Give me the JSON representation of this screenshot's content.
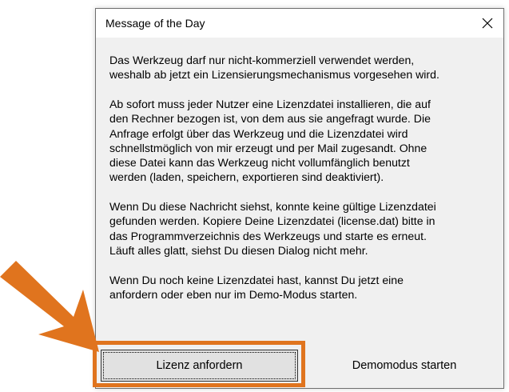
{
  "dialog": {
    "title": "Message of the Day",
    "close_icon": "close-x-icon",
    "paragraphs": [
      "Das Werkzeug darf nur nicht-kommerziell verwendet werden,\nweshalb ab jetzt ein Lizensierungsmechanismus vorgesehen wird.",
      "Ab sofort muss jeder Nutzer eine Lizenzdatei installieren, die auf\nden Rechner bezogen ist, von dem aus sie angefragt wurde. Die\nAnfrage erfolgt über das Werkzeug und die Lizenzdatei wird\nschnellstmöglich von mir erzeugt und per Mail zugesandt. Ohne\ndiese Datei kann das Werkzeug nicht vollumfänglich benutzt\nwerden (laden, speichern, exportieren sind deaktiviert).",
      "Wenn Du diese Nachricht siehst, konnte keine gültige Lizenzdatei\ngefunden werden. Kopiere Deine Lizenzdatei (license.dat) bitte in\ndas Programmverzeichnis des Werkzeugs und starte es erneut.\nLäuft alles glatt, siehst Du diesen Dialog nicht mehr.",
      "Wenn Du noch keine Lizenzdatei hast, kannst Du jetzt eine\nanfordern oder eben nur im Demo-Modus starten."
    ],
    "buttons": {
      "request_license": "Lizenz anfordern",
      "demo_mode": "Demomodus starten"
    }
  },
  "annotation": {
    "arrow_icon": "arrow-icon",
    "highlight_color": "#e0741e"
  }
}
